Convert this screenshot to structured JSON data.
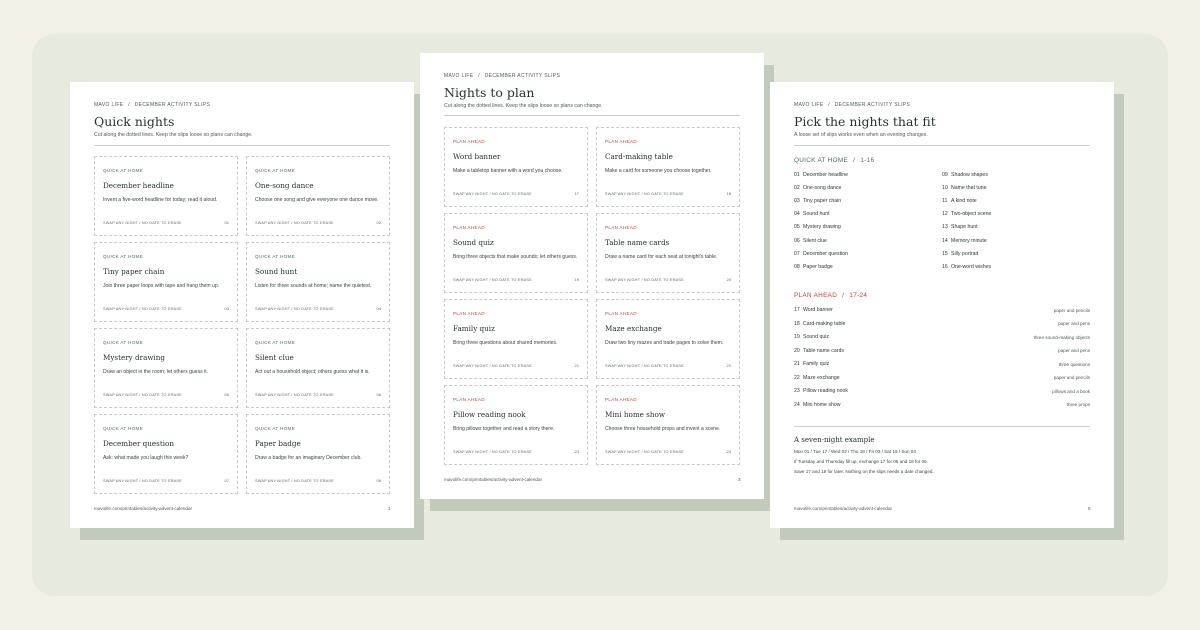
{
  "crumb": {
    "brand": "MAVO LIFE",
    "sep": "/",
    "section": "DECEMBER ACTIVITY SLIPS"
  },
  "page1": {
    "title": "Quick nights",
    "subtitle": "Cut along the dotted lines. Keep the slips loose so plans can change.",
    "footer_url": "mavolife.com/printables/activity-advent-calendar",
    "page_number": "1"
  },
  "page2": {
    "title": "Nights to plan",
    "subtitle": "Cut along the dotted lines. Keep the slips loose so plans can change.",
    "footer_url": "mavolife.com/printables/activity-advent-calendar",
    "page_number": "3"
  },
  "page3": {
    "title": "Pick the nights that fit",
    "subtitle": "A loose set of slips works even when an evening changes.",
    "footer_url": "mavolife.com/printables/activity-advent-calendar",
    "page_number": "5"
  },
  "slip_footer": "SWAP ANY NIGHT  /  NO DATE TO ERASE",
  "quick_slips": [
    {
      "category": "QUICK AT HOME",
      "title": "December headline",
      "desc": "Invent a five-word headline for today; read it aloud.",
      "num": "01"
    },
    {
      "category": "QUICK AT HOME",
      "title": "One-song dance",
      "desc": "Choose one song and give everyone one dance move.",
      "num": "02"
    },
    {
      "category": "QUICK AT HOME",
      "title": "Tiny paper chain",
      "desc": "Join three paper loops with tape and hang them up.",
      "num": "03"
    },
    {
      "category": "QUICK AT HOME",
      "title": "Sound hunt",
      "desc": "Listen for three sounds at home; name the quietest.",
      "num": "04"
    },
    {
      "category": "QUICK AT HOME",
      "title": "Mystery drawing",
      "desc": "Draw an object in the room; let others guess it.",
      "num": "05"
    },
    {
      "category": "QUICK AT HOME",
      "title": "Silent clue",
      "desc": "Act out a household object; others guess what it is.",
      "num": "06"
    },
    {
      "category": "QUICK AT HOME",
      "title": "December question",
      "desc": "Ask: what made you laugh this week?",
      "num": "07"
    },
    {
      "category": "QUICK AT HOME",
      "title": "Paper badge",
      "desc": "Draw a badge for an imaginary December club.",
      "num": "08"
    }
  ],
  "plan_slips": [
    {
      "category": "PLAN AHEAD",
      "title": "Word banner",
      "desc": "Make a tabletop banner with a word you choose.",
      "num": "17"
    },
    {
      "category": "PLAN AHEAD",
      "title": "Card-making table",
      "desc": "Make a card for someone you choose together.",
      "num": "18"
    },
    {
      "category": "PLAN AHEAD",
      "title": "Sound quiz",
      "desc": "Bring three objects that make sounds; let others guess.",
      "num": "19"
    },
    {
      "category": "PLAN AHEAD",
      "title": "Table name cards",
      "desc": "Draw a name card for each seat at tonight's table.",
      "num": "20"
    },
    {
      "category": "PLAN AHEAD",
      "title": "Family quiz",
      "desc": "Bring three questions about shared memories.",
      "num": "21"
    },
    {
      "category": "PLAN AHEAD",
      "title": "Maze exchange",
      "desc": "Draw two tiny mazes and trade pages to solve them.",
      "num": "22"
    },
    {
      "category": "PLAN AHEAD",
      "title": "Pillow reading nook",
      "desc": "Bring pillows together and read a story there.",
      "num": "23"
    },
    {
      "category": "PLAN AHEAD",
      "title": "Mini home show",
      "desc": "Choose three household props and invent a scene.",
      "num": "24"
    }
  ],
  "quick_section": {
    "label": "QUICK AT HOME",
    "sep": "/",
    "range": "1-16"
  },
  "quick_list": [
    {
      "n": "01",
      "label": "December headline"
    },
    {
      "n": "02",
      "label": "One-song dance"
    },
    {
      "n": "03",
      "label": "Tiny paper chain"
    },
    {
      "n": "04",
      "label": "Sound hunt"
    },
    {
      "n": "05",
      "label": "Mystery drawing"
    },
    {
      "n": "06",
      "label": "Silent clue"
    },
    {
      "n": "07",
      "label": "December question"
    },
    {
      "n": "08",
      "label": "Paper badge"
    },
    {
      "n": "09",
      "label": "Shadow shapes"
    },
    {
      "n": "10",
      "label": "Name that tune"
    },
    {
      "n": "11",
      "label": "A kind note"
    },
    {
      "n": "12",
      "label": "Two-object scene"
    },
    {
      "n": "13",
      "label": "Shape hunt"
    },
    {
      "n": "14",
      "label": "Memory minute"
    },
    {
      "n": "15",
      "label": "Silly portrait"
    },
    {
      "n": "16",
      "label": "One-word wishes"
    }
  ],
  "plan_section": {
    "label": "PLAN AHEAD",
    "sep": "/",
    "range": "17-24"
  },
  "plan_list": [
    {
      "n": "17",
      "label": "Word banner",
      "materials": "paper and pencils"
    },
    {
      "n": "18",
      "label": "Card-making table",
      "materials": "paper and pens"
    },
    {
      "n": "19",
      "label": "Sound quiz",
      "materials": "three sound-making objects"
    },
    {
      "n": "20",
      "label": "Table name cards",
      "materials": "paper and pens"
    },
    {
      "n": "21",
      "label": "Family quiz",
      "materials": "three questions"
    },
    {
      "n": "22",
      "label": "Maze exchange",
      "materials": "paper and pencils"
    },
    {
      "n": "23",
      "label": "Pillow reading nook",
      "materials": "pillows and a book"
    },
    {
      "n": "24",
      "label": "Mini home show",
      "materials": "three props"
    }
  ],
  "example": {
    "heading": "A seven-night example",
    "days": "Mon 01  /  Tue 17  /  Wed 02  /  Thu 18  /  Fri 03  /  Sat 19  /  Sun 04",
    "note1": "If Tuesday and Thursday fill up, exchange 17 for 05 and 18 for 06.",
    "note2": "Save 17 and 18 for later. Nothing on the slips needs a date changed."
  }
}
